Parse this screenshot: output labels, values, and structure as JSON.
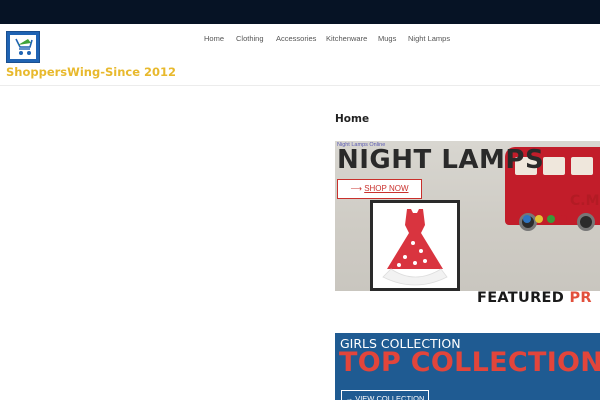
{
  "site": {
    "title": "ShoppersWing-Since 2012"
  },
  "nav": {
    "items": [
      {
        "label": "Home"
      },
      {
        "label": "Clothing"
      },
      {
        "label": "Accessories"
      },
      {
        "label": "Kitchenware"
      },
      {
        "label": "Mugs"
      },
      {
        "label": "Night Lamps"
      }
    ]
  },
  "page": {
    "title": "Home"
  },
  "banner_night_lamps": {
    "small_text": "Night Lamps Online",
    "heading": "NIGHT LAMPS",
    "tail_text": "C.M",
    "button_arrow": "⟶",
    "button_label": "SHOP NOW"
  },
  "featured": {
    "prefix": "FEATURED ",
    "accent": "PR"
  },
  "banner_collection": {
    "subtitle": "GIRLS COLLECTION",
    "heading": "TOP COLLECTION",
    "button_label": "→ VIEW COLLECTION"
  },
  "colors": {
    "topbar": "#061325",
    "site_title": "#e8b92d",
    "accent_red": "#e2503c",
    "collection_blue": "#1f5b92"
  },
  "icons": {
    "logo": "shopping-cart-icon"
  }
}
